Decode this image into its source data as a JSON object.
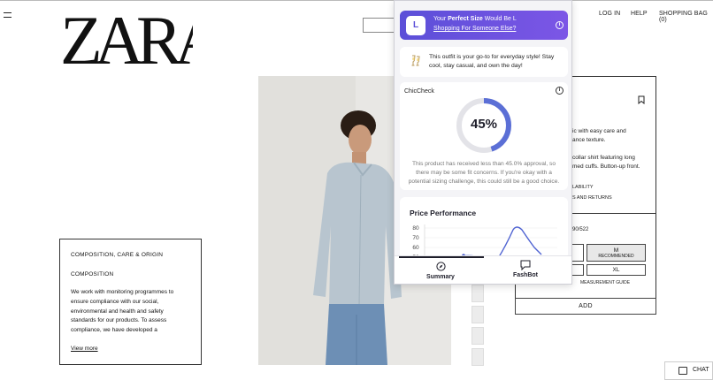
{
  "header": {
    "brand": "ZARA",
    "nav": [
      "LOG IN",
      "HELP",
      "SHOPPING BAG (0)"
    ]
  },
  "composition": {
    "title": "COMPOSITION, CARE & ORIGIN",
    "subtitle": "COMPOSITION",
    "text": "We work with monitoring programmes to ensure compliance with our social, environmental and health and safety standards for our products. To assess compliance, we have developed a",
    "link": "View more"
  },
  "product": {
    "desc1": "ic with easy care and",
    "desc2": "ance texture.",
    "desc3": "collar shirt featuring long",
    "desc4": "med cuffs. Button-up front.",
    "avail": "LABILITY",
    "returns": "S AND RETURNS",
    "ref": "90/522",
    "sizes": [
      {
        "label": "M",
        "note": "RECOMMENDED"
      },
      {
        "label": "XL",
        "note": ""
      }
    ],
    "guide": "MEASUREMENT GUIDE",
    "add": "ADD"
  },
  "chat": {
    "label": "CHAT",
    "icon": "chat-bubble-icon"
  },
  "popup": {
    "banner": {
      "size": "L",
      "line1_pre": "Your ",
      "line1_bold": "Perfect Size",
      "line1_post": " Would Be L",
      "line2": "Shopping For Someone Else?"
    },
    "style_tip": {
      "icon": "champagne-icon",
      "text": "This outfit is your go-to for everyday style! Stay cool, stay casual, and own the day!"
    },
    "chiccheck": {
      "title": "ChicCheck",
      "percent": 45,
      "percent_label": "45%",
      "text": "This product has received less than 45.0% approval, so there may be some fit concerns. If you're okay with a potential sizing challenge, this could still be a good choice."
    },
    "price": {
      "title": "Price Performance",
      "ticks": [
        "80",
        "70",
        "60",
        "50"
      ]
    },
    "nav": [
      {
        "label": "Summary",
        "icon": "compass-icon"
      },
      {
        "label": "FashBot",
        "icon": "chat-icon"
      }
    ]
  },
  "colors": {
    "accent": "#6452de",
    "gauge": "#5b6fd6"
  }
}
